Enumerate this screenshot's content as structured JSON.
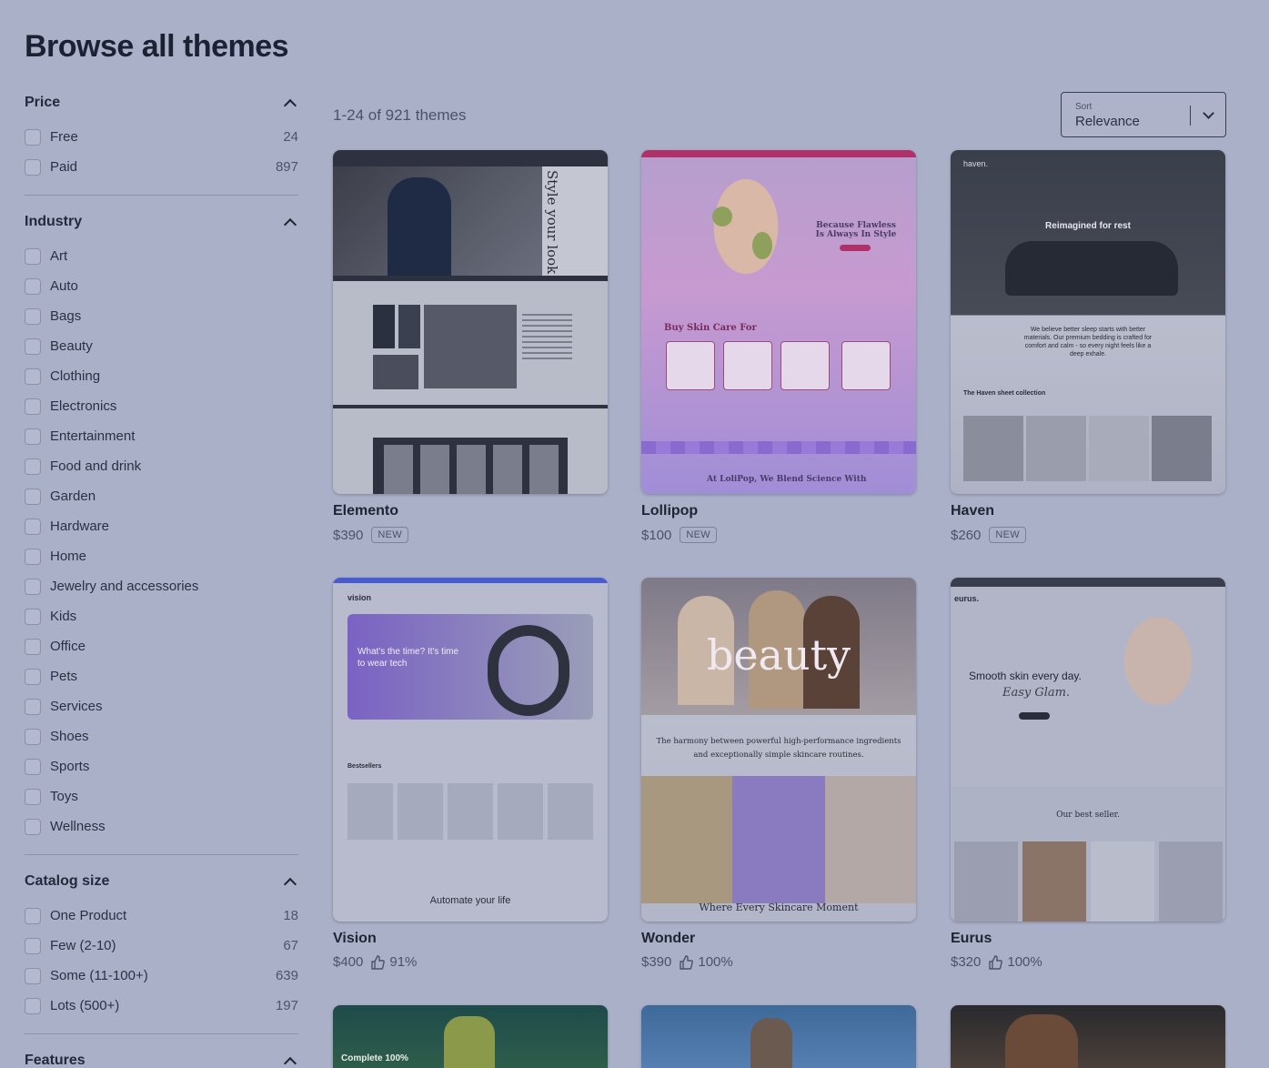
{
  "page": {
    "title": "Browse all themes"
  },
  "filters": {
    "price": {
      "title": "Price",
      "items": [
        {
          "label": "Free",
          "count": "24"
        },
        {
          "label": "Paid",
          "count": "897"
        }
      ]
    },
    "industry": {
      "title": "Industry",
      "items": [
        {
          "label": "Art"
        },
        {
          "label": "Auto"
        },
        {
          "label": "Bags"
        },
        {
          "label": "Beauty"
        },
        {
          "label": "Clothing"
        },
        {
          "label": "Electronics"
        },
        {
          "label": "Entertainment"
        },
        {
          "label": "Food and drink"
        },
        {
          "label": "Garden"
        },
        {
          "label": "Hardware"
        },
        {
          "label": "Home"
        },
        {
          "label": "Jewelry and accessories"
        },
        {
          "label": "Kids"
        },
        {
          "label": "Office"
        },
        {
          "label": "Pets"
        },
        {
          "label": "Services"
        },
        {
          "label": "Shoes"
        },
        {
          "label": "Sports"
        },
        {
          "label": "Toys"
        },
        {
          "label": "Wellness"
        }
      ]
    },
    "catalog_size": {
      "title": "Catalog size",
      "items": [
        {
          "label": "One Product",
          "count": "18"
        },
        {
          "label": "Few (2-10)",
          "count": "67"
        },
        {
          "label": "Some (11-100+)",
          "count": "639"
        },
        {
          "label": "Lots (500+)",
          "count": "197"
        }
      ]
    },
    "features": {
      "title": "Features"
    }
  },
  "results": {
    "summary": "1-24 of 921 themes"
  },
  "sort": {
    "label": "Sort",
    "value": "Relevance"
  },
  "themes": [
    {
      "name": "Elemento",
      "price": "$390",
      "badge": "NEW"
    },
    {
      "name": "Lollipop",
      "price": "$100",
      "badge": "NEW"
    },
    {
      "name": "Haven",
      "price": "$260",
      "badge": "NEW"
    },
    {
      "name": "Vision",
      "price": "$400",
      "rating": "91%"
    },
    {
      "name": "Wonder",
      "price": "$390",
      "rating": "100%"
    },
    {
      "name": "Eurus",
      "price": "$320",
      "rating": "100%"
    }
  ],
  "thumb_text": {
    "elemento_tag": "Style your look",
    "lollipop_headline": "Because Flawless Is Always In Style",
    "lollipop_section": "Buy Skin Care For",
    "lollipop_footer": "At LoliPop, We Blend Science With",
    "haven_logo": "haven.",
    "haven_headline": "Reimagined for rest",
    "haven_body": "We believe better sleep starts with better materials. Our premium bedding is crafted for comfort and calm - so every night feels like a deep exhale.",
    "haven_collection": "The Haven sheet collection",
    "vision_logo": "vision",
    "vision_headline": "What's the time? It's time to wear tech",
    "vision_section": "Bestsellers",
    "vision_footer": "Automate your life",
    "wonder_hero": "beauty",
    "wonder_body": "The harmony between powerful high-performance ingredients and exceptionally simple skincare routines.",
    "wonder_footer": "Where Every Skincare Moment",
    "eurus_logo": "eurus.",
    "eurus_headline": "Smooth skin every day.",
    "eurus_sub": "Easy Glam.",
    "eurus_section": "Our best seller.",
    "flow_headline": "Complete 100%"
  },
  "colors": {
    "overlay": "#aab0c8",
    "accent": "#5b5bd6"
  }
}
